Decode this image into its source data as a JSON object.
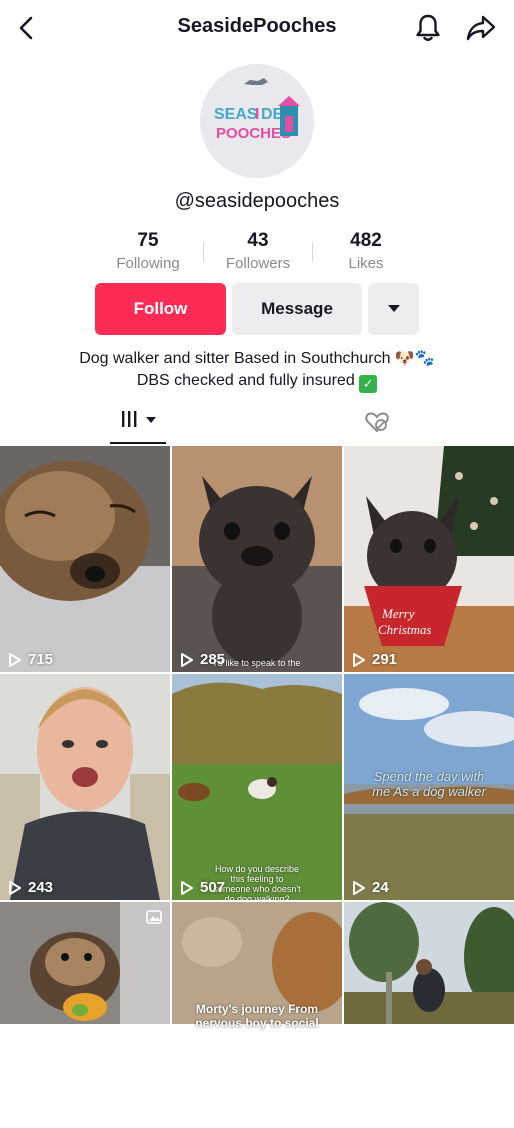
{
  "header": {
    "title": "SeasidePooches"
  },
  "profile": {
    "avatar_logo_text": "SEASIDE POOCHES",
    "handle": "@seasidepooches",
    "stats": [
      {
        "value": "75",
        "label": "Following"
      },
      {
        "value": "43",
        "label": "Followers"
      },
      {
        "value": "482",
        "label": "Likes"
      }
    ],
    "follow_label": "Follow",
    "message_label": "Message",
    "bio_line1": "Dog walker and sitter Based in Southchurch 🐶🐾",
    "bio_line2": "DBS checked and fully insured"
  },
  "videos": [
    {
      "views": "715",
      "caption": ""
    },
    {
      "views": "285",
      "caption": "I'd like to speak to the"
    },
    {
      "views": "291",
      "caption": ""
    },
    {
      "views": "243",
      "caption": ""
    },
    {
      "views": "507",
      "caption": "How do you describe this feeling to someone who doesn't do dog walking?"
    },
    {
      "views": "24",
      "caption": "Spend the day with me As a dog walker"
    },
    {
      "views": "",
      "caption": ""
    },
    {
      "views": "",
      "caption": "Morty's journey From nervous boy to social"
    },
    {
      "views": "",
      "caption": ""
    }
  ],
  "colors": {
    "accent": "#fe2c55",
    "secondary_button": "#ededf0",
    "text": "#161823",
    "muted": "#8a8b91"
  },
  "icons": {
    "back": "chevron-left-icon",
    "bell": "bell-icon",
    "share": "share-arrow-icon",
    "dropdown": "caret-down-icon",
    "videos_tab": "grid-bars-icon",
    "liked_tab": "hidden-heart-icon",
    "play": "play-outline-icon",
    "photo": "photo-icon"
  }
}
